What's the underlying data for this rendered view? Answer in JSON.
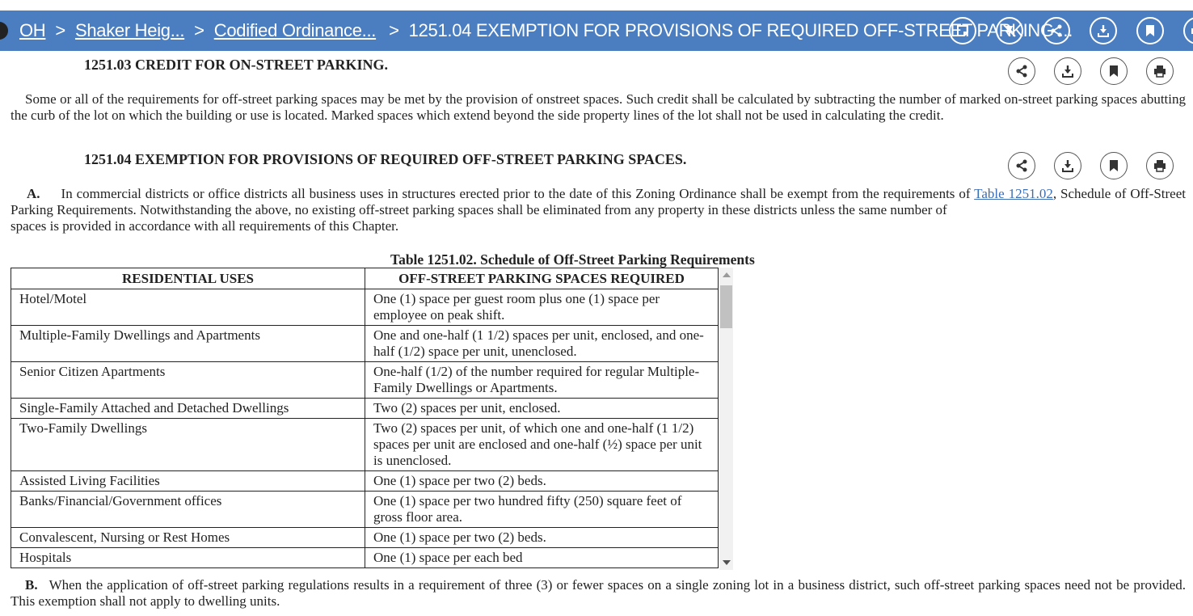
{
  "breadcrumb": {
    "state": "OH",
    "city": "Shaker Heig...",
    "code": "Codified Ordinance...",
    "current": "1251.04 EXEMPTION FOR PROVISIONS OF REQUIRED OFF-STREET PARKING ...",
    "separator": ">"
  },
  "top_icons": [
    "notes-icon",
    "annotations-off-icon",
    "share-icon",
    "download-icon",
    "bookmark-icon",
    "print-icon"
  ],
  "section_1251_03": {
    "title": "1251.03 CREDIT FOR ON-STREET PARKING.",
    "body": "Some or all of the requirements for off-street parking spaces may be met by the provision of onstreet spaces. Such credit shall be calculated by subtracting the number of marked on-street parking spaces abutting the curb of the lot on which the building or use is located. Marked spaces which extend beyond the side property lines of the lot shall not be used in calculating the credit."
  },
  "section_1251_04": {
    "title": "1251.04 EXEMPTION FOR PROVISIONS OF REQUIRED OFF-STREET PARKING SPACES.",
    "a_label": "A.",
    "a_text_1": "In commercial districts or office districts all business uses in structures erected prior to the date of this Zoning Ordinance shall be exempt from the requirements of",
    "a_link": "Table 1251.02",
    "a_text_2": ", Schedule of Off-Street Parking Requirements. Notwithstanding the above, no existing off-street parking spaces shall be eliminated from any property in these districts unless the same number of",
    "a_text_3": "spaces is provided in accordance with all requirements of this Chapter.",
    "b_label": "B.",
    "b_text": "When the application of off-street parking regulations results in a requirement of three (3) or fewer spaces on a single zoning lot in a business district, such off-street parking spaces need not be provided. This exemption shall not apply to dwelling units."
  },
  "table": {
    "caption": "Table 1251.02. Schedule of Off-Street Parking Requirements",
    "headers": [
      "RESIDENTIAL USES",
      "OFF-STREET PARKING SPACES REQUIRED"
    ],
    "rows": [
      [
        "Hotel/Motel",
        "One (1) space per guest room plus one (1) space per employee on peak shift."
      ],
      [
        "Multiple-Family Dwellings and Apartments",
        "One and one-half (1 1/2) spaces per unit, enclosed, and one-half (1/2) space per unit, unenclosed."
      ],
      [
        "Senior Citizen Apartments",
        "One-half (1/2) of the number required for regular Multiple-Family Dwellings or Apartments."
      ],
      [
        "Single-Family Attached and Detached Dwellings",
        "Two (2) spaces per unit, enclosed."
      ],
      [
        "Two-Family Dwellings",
        "Two (2) spaces per unit, of which one and one-half (1 1/2) spaces per unit are enclosed and one-half (½) space per unit is unenclosed."
      ],
      [
        "Assisted Living Facilities",
        "One (1) space per two (2) beds."
      ],
      [
        "Banks/Financial/Government offices",
        "One (1) space per two hundred fifty (250) square feet of gross floor area."
      ],
      [
        "Convalescent, Nursing or Rest Homes",
        "One (1) space per two (2) beds."
      ],
      [
        "Hospitals",
        "One (1) space per each bed"
      ]
    ]
  }
}
